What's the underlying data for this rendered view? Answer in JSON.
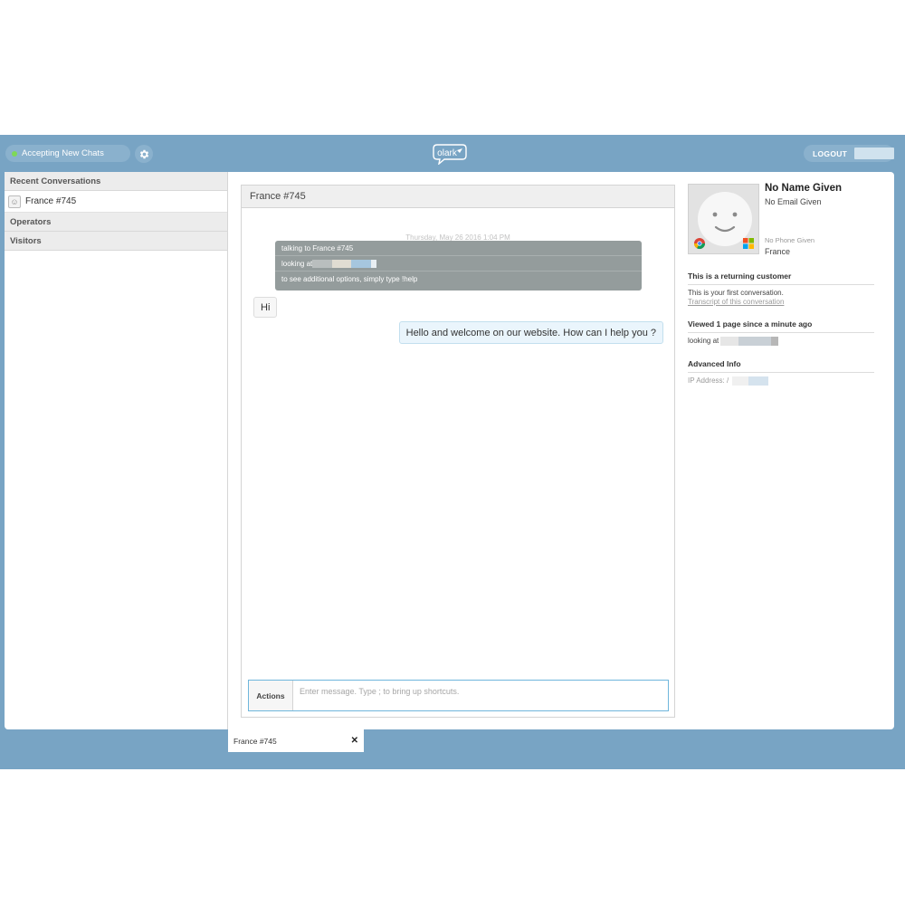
{
  "topbar": {
    "status_label": "Accepting New Chats",
    "logout_label": "LOGOUT",
    "logo_text": "olark"
  },
  "sidebar": {
    "recent_header": "Recent Conversations",
    "conversation_label": "France #745",
    "operators_header": "Operators",
    "visitors_header": "Visitors"
  },
  "chat": {
    "title": "France #745",
    "date": "Thursday, May 26 2016 1:04 PM",
    "system": {
      "talking_to": "talking to France #745",
      "looking_at": "looking at",
      "options": "to see additional options, simply type !help"
    },
    "incoming_message": "Hi",
    "outgoing_message": "Hello and welcome on our website. How can I help you ?",
    "actions_label": "Actions",
    "input_placeholder": "Enter message. Type ; to bring up shortcuts."
  },
  "visitor": {
    "name": "No Name Given",
    "email": "No Email Given",
    "phone": "No Phone Given",
    "country": "France",
    "returning_title": "This is a returning customer",
    "first_conversation": "This is your first conversation.",
    "transcript_link": "Transcript of this conversation",
    "viewed_title": "Viewed 1 page since a minute ago",
    "looking_at": "looking at",
    "advanced_title": "Advanced Info",
    "ip_label": "IP Address: /"
  },
  "bottom_tab": {
    "label": "France #745"
  },
  "colors": {
    "background": "#78a4c4",
    "status_dot": "#7ed957",
    "system_block": "#949c9c",
    "outgoing_bubble": "#eaf5fc"
  }
}
